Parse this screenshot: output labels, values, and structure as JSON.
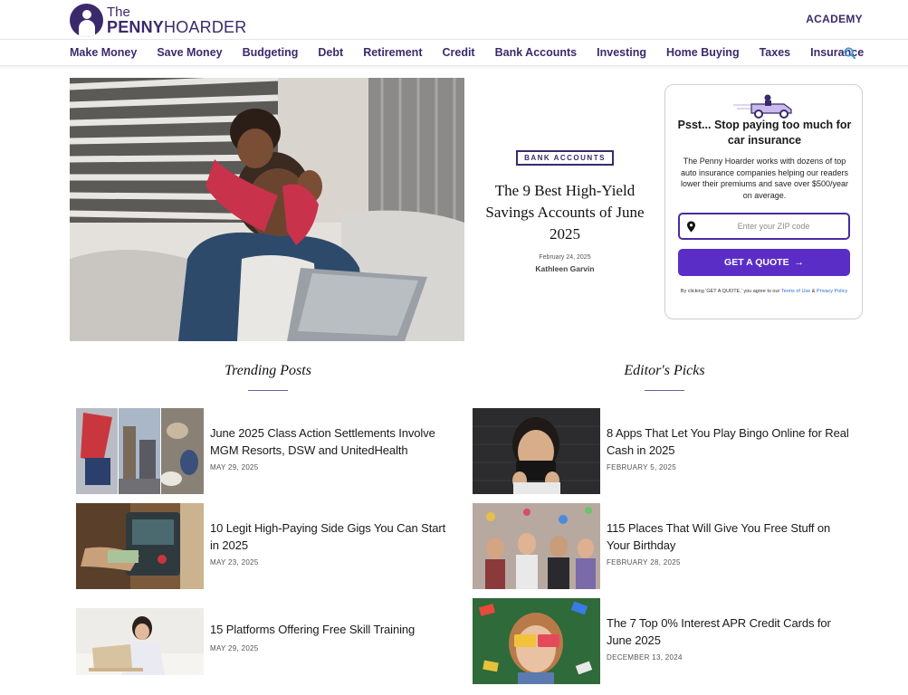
{
  "brand": {
    "logo_the": "The",
    "logo_penny": "PENNY",
    "logo_hoarder": "HOARDER",
    "color_primary": "#3b2a6b",
    "color_button": "#5a2ec6"
  },
  "header": {
    "academy_label": "ACADEMY"
  },
  "nav": {
    "items": [
      {
        "label": "Make Money"
      },
      {
        "label": "Save Money"
      },
      {
        "label": "Budgeting"
      },
      {
        "label": "Debt"
      },
      {
        "label": "Retirement"
      },
      {
        "label": "Credit"
      },
      {
        "label": "Bank Accounts"
      },
      {
        "label": "Investing"
      },
      {
        "label": "Home Buying"
      },
      {
        "label": "Taxes"
      },
      {
        "label": "Insurance"
      }
    ],
    "search_icon": "search-icon"
  },
  "hero": {
    "tag": "BANK ACCOUNTS",
    "title": "The 9 Best High-Yield Savings Accounts of June 2025",
    "date": "February 24, 2025",
    "author": "Kathleen Garvin"
  },
  "quote_card": {
    "title": "Psst... Stop paying too much for car insurance",
    "body": "The Penny Hoarder works with dozens of top auto insurance companies helping our readers lower their premiums and save over $500/year on average.",
    "zip_placeholder": "Enter your ZIP code",
    "button_label": "GET A QUOTE",
    "fine_prefix": "By clicking 'GET A QUOTE,' you agree to our",
    "terms_label": "Terms of Use",
    "fine_and": "&",
    "privacy_label": "Privacy Policy"
  },
  "trending": {
    "title": "Trending Posts",
    "posts": [
      {
        "title": "June 2025 Class Action Settlements Involve MGM Resorts, DSW and UnitedHealth",
        "date": "MAY 29, 2025"
      },
      {
        "title": "10 Legit High-Paying Side Gigs You Can Start in 2025",
        "date": "MAY 23, 2025"
      },
      {
        "title": "15 Platforms Offering Free Skill Training",
        "date": "MAY 29, 2025"
      }
    ]
  },
  "editors": {
    "title": "Editor's Picks",
    "posts": [
      {
        "title": "8 Apps That Let You Play Bingo Online for Real Cash in 2025",
        "date": "FEBRUARY 5, 2025"
      },
      {
        "title": "115 Places That Will Give You Free Stuff on Your Birthday",
        "date": "FEBRUARY 28, 2025"
      },
      {
        "title": "The 7 Top 0% Interest APR Credit Cards for June 2025",
        "date": "DECEMBER 13, 2024"
      }
    ]
  }
}
